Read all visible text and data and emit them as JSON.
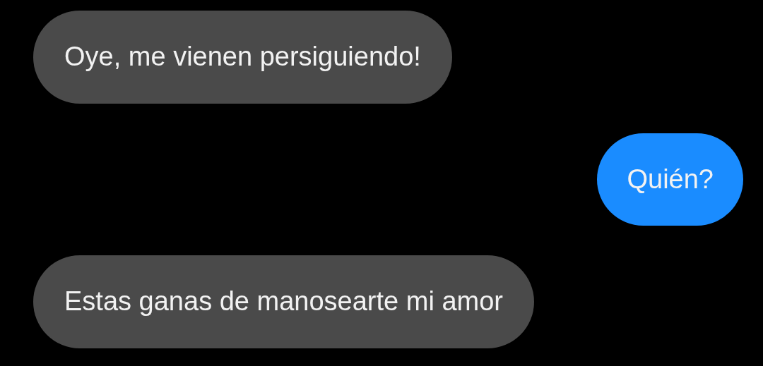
{
  "messages": [
    {
      "kind": "received",
      "text": "Oye, me vienen persiguiendo!"
    },
    {
      "kind": "sent",
      "text": "Quién?"
    },
    {
      "kind": "received",
      "text": "Estas ganas de manosearte mi amor"
    }
  ]
}
